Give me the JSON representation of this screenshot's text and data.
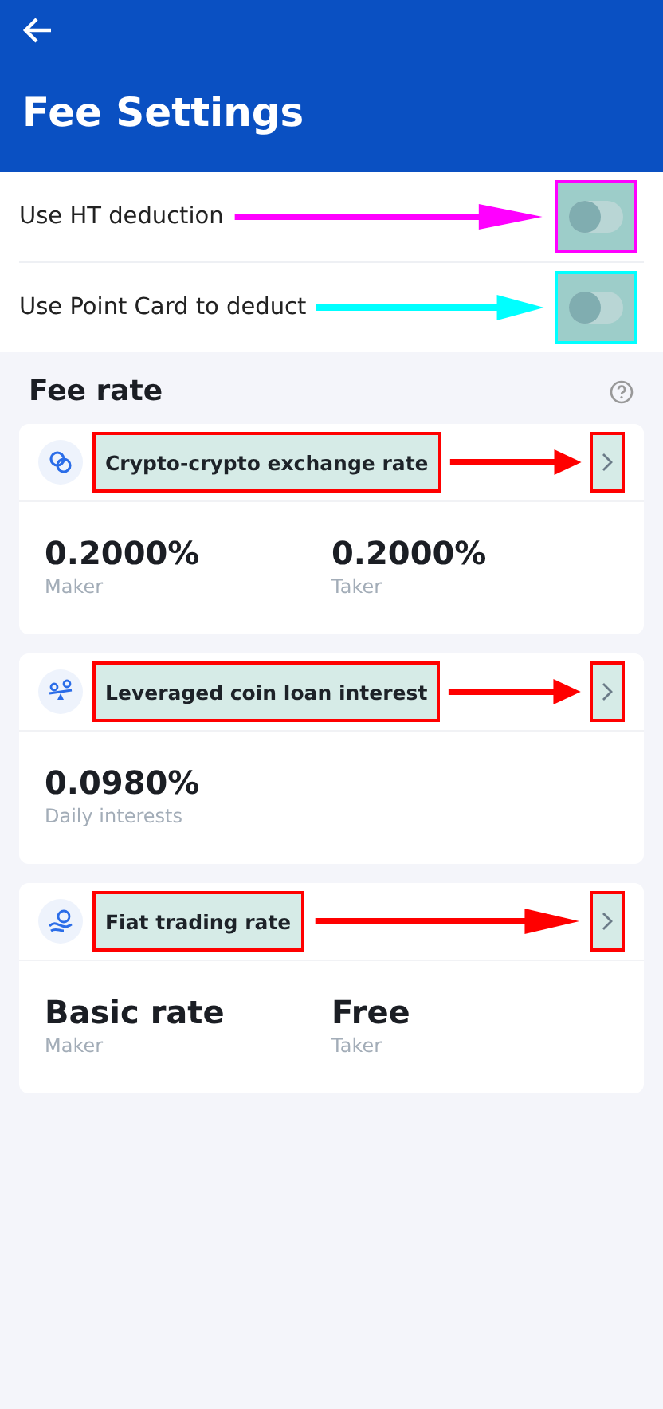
{
  "header": {
    "title": "Fee Settings"
  },
  "toggles": [
    {
      "label": "Use HT deduction",
      "on": false,
      "color": "#ff00ff"
    },
    {
      "label": "Use Point Card to deduct",
      "on": false,
      "color": "#00ffff"
    }
  ],
  "fee_rate": {
    "title": "Fee rate",
    "cards": [
      {
        "kind": "exchange",
        "title": "Crypto-crypto exchange rate",
        "color": "#ff0000",
        "values": [
          {
            "value": "0.2000%",
            "label": "Maker"
          },
          {
            "value": "0.2000%",
            "label": "Taker"
          }
        ]
      },
      {
        "kind": "loan",
        "title": "Leveraged coin loan interest",
        "color": "#ff0000",
        "values": [
          {
            "value": "0.0980%",
            "label": "Daily interests"
          }
        ]
      },
      {
        "kind": "fiat",
        "title": "Fiat trading rate",
        "color": "#ff0000",
        "values": [
          {
            "value": "Basic rate",
            "label": "Maker"
          },
          {
            "value": "Free",
            "label": "Taker"
          }
        ]
      }
    ]
  }
}
